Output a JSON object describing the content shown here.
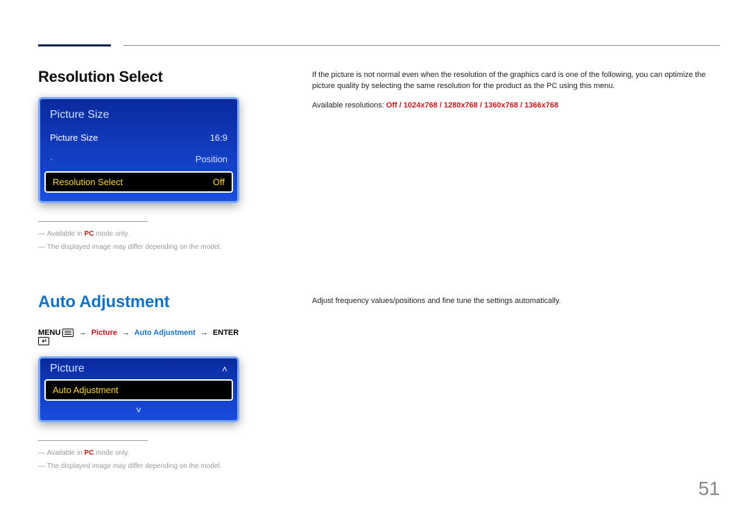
{
  "section1": {
    "heading": "Resolution Select",
    "osd_title": "Picture Size",
    "row1": {
      "label": "Picture Size",
      "value": "16:9"
    },
    "row2_label": "Position",
    "row3": {
      "label": "Resolution Select",
      "value": "Off"
    },
    "note1_prefix": "Available in ",
    "note1_bold": "PC",
    "note1_suffix": " mode only.",
    "note2": "The displayed image may differ depending on the model."
  },
  "right1": {
    "paragraph": "If the picture is not normal even when the resolution of the graphics card is one of the following, you can optimize the picture quality by selecting the same resolution for the product as the PC using this menu.",
    "avail_lead": "Available resolutions: ",
    "avail_values": "Off / 1024x768 / 1280x768 / 1360x768 / 1366x768"
  },
  "section2": {
    "heading": "Auto Adjustment",
    "menu_label": "MENU",
    "picture_step": "Picture",
    "autoadj_step": "Auto Adjustment",
    "enter_label": "ENTER",
    "arrow": "→",
    "osd_title": "Picture",
    "row_sel": "Auto Adjustment",
    "note1_prefix": "Available in ",
    "note1_bold": "PC",
    "note1_suffix": " mode only.",
    "note2": "The displayed image may differ depending on the model."
  },
  "right2": {
    "paragraph": "Adjust frequency values/positions and fine tune the settings automatically."
  },
  "pageNumber": "51"
}
